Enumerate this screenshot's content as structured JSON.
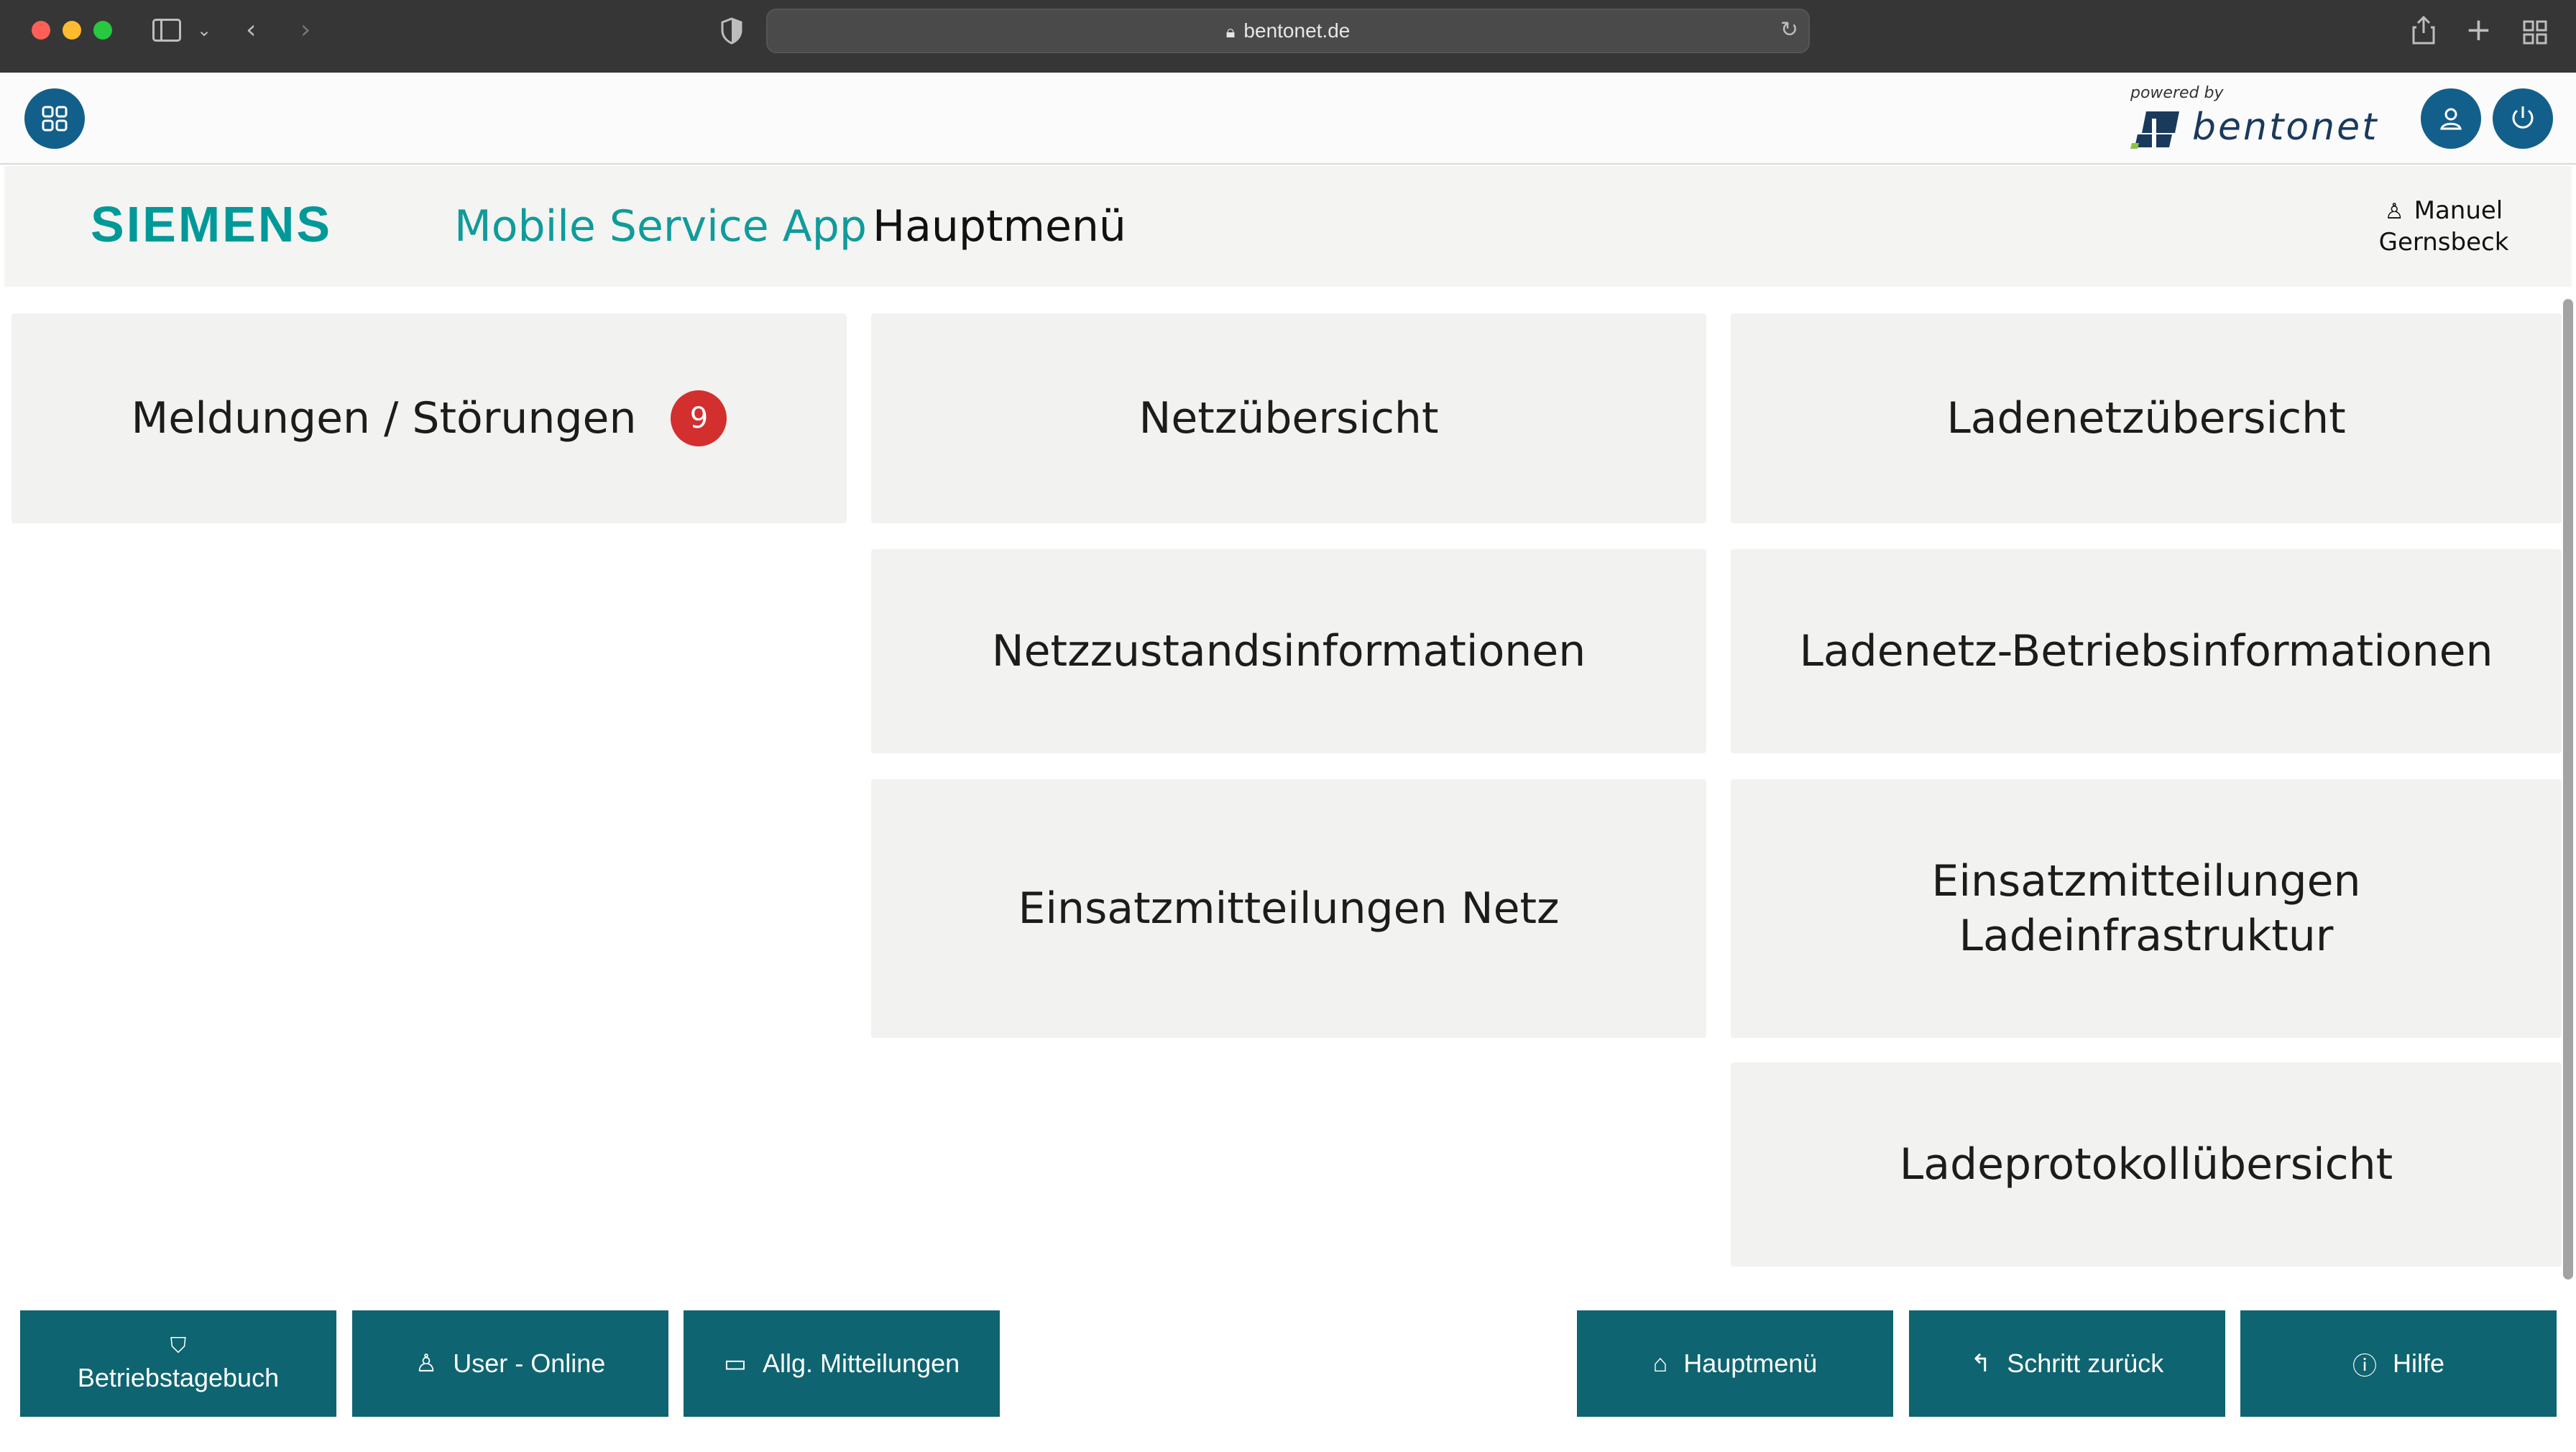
{
  "browser": {
    "url": "bentonet.de",
    "icons": [
      "sidebar-icon",
      "chevron-down-icon",
      "back-arrow-icon",
      "forward-arrow-icon",
      "shield-icon",
      "lock-icon",
      "reload-icon",
      "share-icon",
      "plus-icon",
      "tabs-grid-icon"
    ]
  },
  "header": {
    "powered_by": "powered by",
    "vendor_logo": "bentonet",
    "icons": [
      "apps-grid-icon",
      "user-icon",
      "power-icon"
    ]
  },
  "titlebar": {
    "brand": "SIEMENS",
    "app_name": "Mobile Service App",
    "page_title": "Hauptmenü",
    "user_first": "Manuel",
    "user_last": "Gernsbeck",
    "user_icon": "user-outline-icon"
  },
  "tiles": {
    "meldungen": "Meldungen / Störungen",
    "meldungen_count": "9",
    "netzuebersicht": "Netzübersicht",
    "ladenetzuebersicht": "Ladenetzübersicht",
    "netzzustand": "Netzzustandsinformationen",
    "ladenetz_betrieb": "Ladenetz-Betriebsinformationen",
    "einsatz_netz": "Einsatzmitteilungen Netz",
    "einsatz_lade_1": "Einsatzmitteilungen",
    "einsatz_lade_2": "Ladeinfrastruktur",
    "ladeprotokoll": "Ladeprotokollübersicht"
  },
  "bottom": {
    "betriebstagebuch": "Betriebstagebuch",
    "user_online": "User - Online",
    "allg_mitteilungen": "Allg. Mitteilungen",
    "hauptmenue": "Hauptmenü",
    "schritt_zurueck": "Schritt zurück",
    "hilfe": "Hilfe"
  },
  "colors": {
    "brand_teal": "#009999",
    "button_teal": "#0e6470",
    "header_blue": "#135f8c",
    "badge_red": "#d32f2f",
    "tile_bg": "#f2f2f0"
  }
}
